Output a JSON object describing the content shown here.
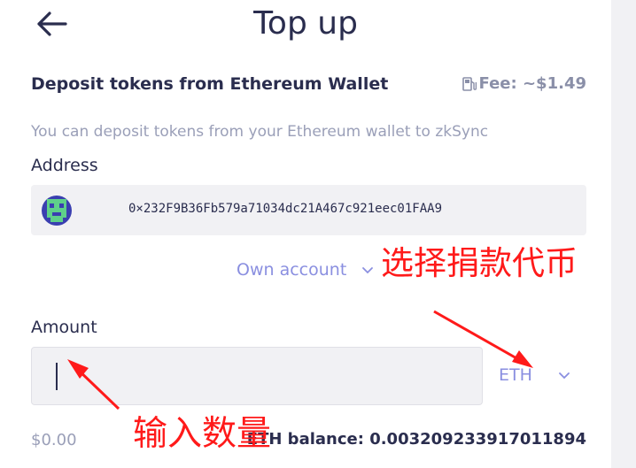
{
  "header": {
    "title": "Top up"
  },
  "deposit": {
    "heading": "Deposit tokens from Ethereum Wallet",
    "fee": "Fee: ~$1.49",
    "description": "You can deposit tokens from your Ethereum wallet to zkSync"
  },
  "address": {
    "label": "Address",
    "value": "0×232F9B36Fb579a71034dc21A467c921eec01FAA9",
    "account_type": "Own account"
  },
  "amount": {
    "label": "Amount",
    "input_value": "",
    "token": "ETH",
    "usd_value": "$0.00",
    "balance": "ETH balance: 0.003209233917011894"
  },
  "annotations": {
    "select_token": "选择捐款代币",
    "enter_amount": "输入数量"
  },
  "colors": {
    "accent": "#8a8fe0",
    "text": "#2a2d4e",
    "annotation": "#ff1a1a"
  }
}
